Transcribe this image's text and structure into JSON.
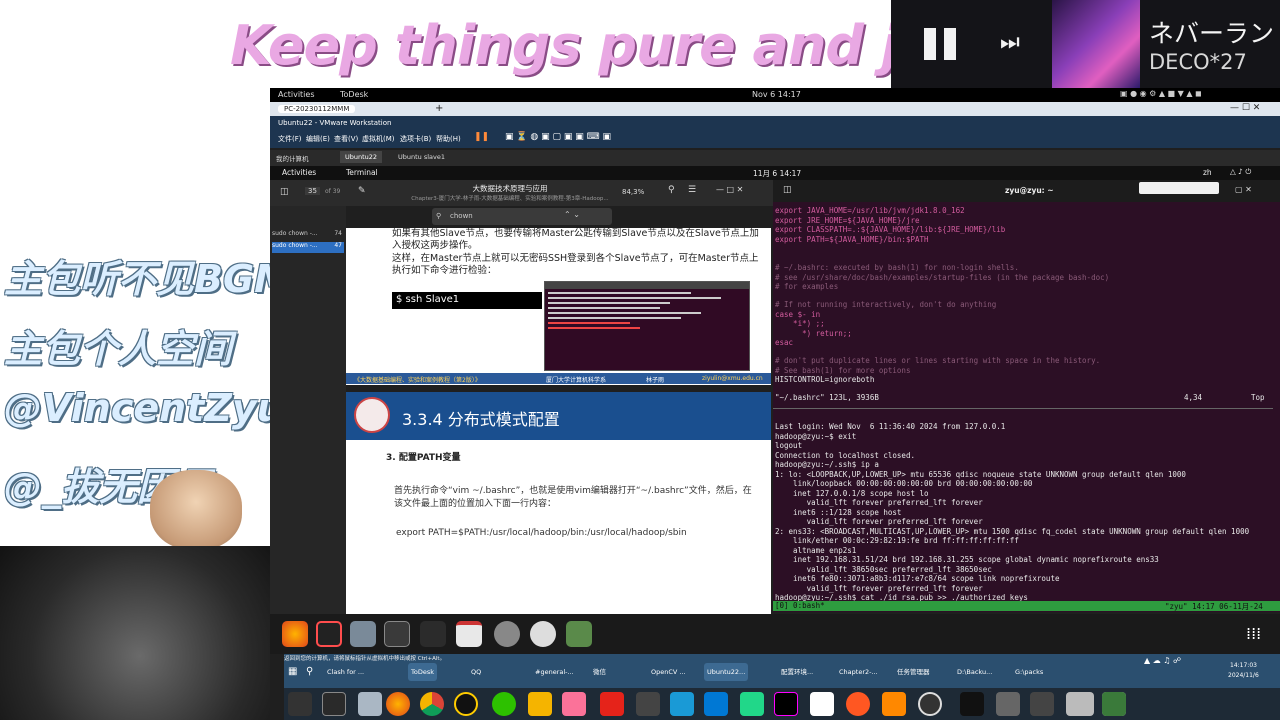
{
  "overlay": {
    "banner": "Keep things pure and joyful",
    "captions": [
      "主包听不见BGM",
      "主包个人空间",
      "@VincentZyu",
      "@_拔无因果_"
    ]
  },
  "player": {
    "song_title": "ネバーラン",
    "artist": "DECO*27",
    "pause_icon": "pause-icon",
    "skip_icon": "skip-next-icon"
  },
  "gnome": {
    "activities": "Activities",
    "app": "ToDesk",
    "clock": "Nov 6  14:17"
  },
  "vmware": {
    "tab": "PC-20230112MMM",
    "window_title": "Ubuntu22 - VMware Workstation",
    "menu": [
      "文件(F)",
      "编辑(E)",
      "查看(V)",
      "虚拟机(M)",
      "选项卡(B)",
      "帮助(H)"
    ],
    "vm_tabs": [
      "我的计算机",
      "Ubuntu22",
      "Ubuntu slave1"
    ]
  },
  "guest_bar": {
    "activities": "Activities",
    "app": "Terminal",
    "clock": "11月 6  14:17",
    "lang": "zh"
  },
  "doc_viewer": {
    "page_num": "35",
    "page_total": "of 39",
    "title": "大数据技术原理与应用",
    "subtitle": "Chapter3-厦门大学-林子雨-大数据基础编程、实验和案例教程-第3章-Hadoop...",
    "zoom": "84,3%",
    "search_value": "chown",
    "results": [
      {
        "text": "sudo chown -...",
        "page": "74"
      },
      {
        "text": "sudo chown -...",
        "page": "47"
      }
    ],
    "para1": "如果有其他Slave节点，也要传输将Master公匙传输到Slave节点以及在Slave节点上加入授权这两步操作。",
    "para2": "这样，在Master节点上就可以无密码SSH登录到各个Slave节点了，可在Master节点上执行如下命令进行检验：",
    "cmd_box": "$ ssh Slave1",
    "footer_left": "《大数据基础编程、实验和案例教程（第2版）》",
    "footer_mid": "厦门大学计算机科学系",
    "footer_author": "林子雨",
    "footer_email": "ziyulin@xmu.edu.cn",
    "section_title": "3.3.4 分布式模式配置",
    "step_heading": "3. 配置PATH变量",
    "step_text": "首先执行命令“vim ~/.bashrc”，也就是使用vim编辑器打开“~/.bashrc”文件，然后，在该文件最上面的位置加入下面一行内容：",
    "export_line": "export PATH=$PATH:/usr/local/hadoop/bin:/usr/local/hadoop/sbin"
  },
  "terminal": {
    "title": "zyu@zyu: ~",
    "vim_lines": [
      "export JAVA_HOME=/usr/lib/jvm/jdk1.8.0_162",
      "export JRE_HOME=${JAVA_HOME}/jre",
      "export CLASSPATH=.:${JAVA_HOME}/lib:${JRE_HOME}/lib",
      "export PATH=${JAVA_HOME}/bin:$PATH",
      "",
      "# ~/.bashrc: executed by bash(1) for non-login shells.",
      "# see /usr/share/doc/bash/examples/startup-files (in the package bash-doc)",
      "# for examples",
      "",
      "# If not running interactively, don't do anything",
      "case $- in",
      "    *i*) ;;",
      "      *) return;;",
      "esac",
      "",
      "# don't put duplicate lines or lines starting with space in the history.",
      "# See bash(1) for more options",
      "HISTCONTROL=ignoreboth"
    ],
    "vim_status_left": "\"~/.bashrc\" 123L, 3936B",
    "vim_status_pos": "4,34",
    "vim_status_right": "Top",
    "shell_lines": [
      "Last login: Wed Nov  6 11:36:40 2024 from 127.0.0.1",
      "hadoop@zyu:~$ exit",
      "logout",
      "Connection to localhost closed.",
      "hadoop@zyu:~/.ssh$ ip a",
      "1: lo: <LOOPBACK,UP,LOWER_UP> mtu 65536 qdisc noqueue state UNKNOWN group default qlen 1000",
      "    link/loopback 00:00:00:00:00:00 brd 00:00:00:00:00:00",
      "    inet 127.0.0.1/8 scope host lo",
      "       valid_lft forever preferred_lft forever",
      "    inet6 ::1/128 scope host",
      "       valid_lft forever preferred_lft forever",
      "2: ens33: <BROADCAST,MULTICAST,UP,LOWER_UP> mtu 1500 qdisc fq_codel state UNKNOWN group default qlen 1000",
      "    link/ether 00:0c:29:82:19:fe brd ff:ff:ff:ff:ff:ff",
      "    altname enp2s1",
      "    inet 192.168.31.51/24 brd 192.168.31.255 scope global dynamic noprefixroute ens33",
      "       valid_lft 38650sec preferred_lft 38650sec",
      "    inet6 fe80::3071:a8b3:d117:e7c8/64 scope link noprefixroute",
      "       valid_lft forever preferred_lft forever",
      "hadoop@zyu:~/.ssh$ cat ./id_rsa.pub >> ./authorized_keys"
    ],
    "tmux_left": "[0] 0:bash*",
    "tmux_right": "\"zyu\" 14:17 06-11月-24"
  },
  "host_taskbar": {
    "notice": "返回到您的计算机，请将鼠标指针从虚拟机中移出或按 Ctrl+Alt。",
    "items": [
      "Clash for ...",
      "ToDesk",
      "QQ",
      "#general-...",
      "微信",
      "OpenCV ...",
      "Ubuntu22...",
      "配置环境...",
      "Chapter2-...",
      "任务管理器",
      "D:\\Backu...",
      "G:\\packs"
    ],
    "clock": "14:17:03",
    "date": "2024/11/6"
  },
  "colors": {
    "terminal_bg": "#2c0f25",
    "slide_banner": "#1a4f8f",
    "tmux_bar": "#2e9c3f"
  }
}
